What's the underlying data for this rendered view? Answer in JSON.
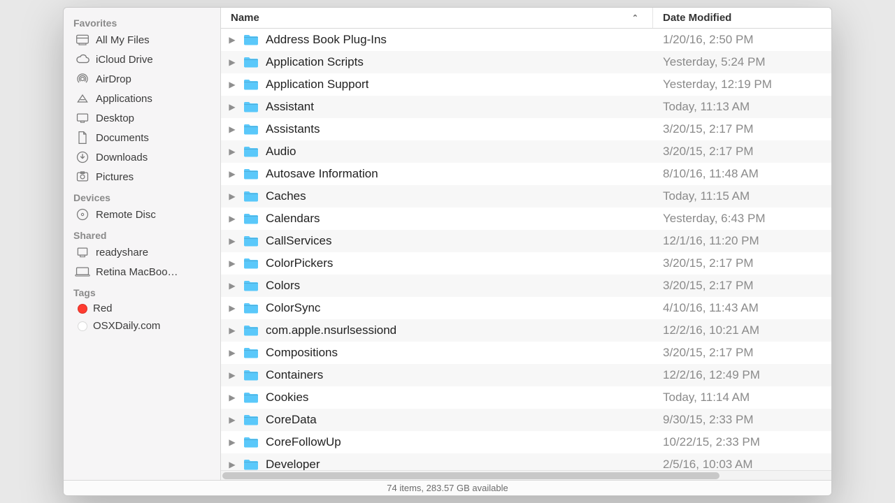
{
  "columns": {
    "name": "Name",
    "date": "Date Modified"
  },
  "sort_indicator": "ascending",
  "sidebar": {
    "sections": [
      {
        "title": "Favorites",
        "items": [
          {
            "icon": "all-my-files-icon",
            "label": "All My Files"
          },
          {
            "icon": "icloud-icon",
            "label": "iCloud Drive"
          },
          {
            "icon": "airdrop-icon",
            "label": "AirDrop"
          },
          {
            "icon": "applications-icon",
            "label": "Applications"
          },
          {
            "icon": "desktop-icon",
            "label": "Desktop"
          },
          {
            "icon": "documents-icon",
            "label": "Documents"
          },
          {
            "icon": "downloads-icon",
            "label": "Downloads"
          },
          {
            "icon": "pictures-icon",
            "label": "Pictures"
          }
        ]
      },
      {
        "title": "Devices",
        "items": [
          {
            "icon": "remote-disc-icon",
            "label": "Remote Disc"
          }
        ]
      },
      {
        "title": "Shared",
        "items": [
          {
            "icon": "pc-icon",
            "label": "readyshare"
          },
          {
            "icon": "mac-icon",
            "label": "Retina MacBoo…"
          }
        ]
      },
      {
        "title": "Tags",
        "items": [
          {
            "icon": "tag-dot",
            "color": "#ff3b30",
            "label": "Red"
          },
          {
            "icon": "tag-dot",
            "color": "#ffffff",
            "label": "OSXDaily.com"
          }
        ]
      }
    ]
  },
  "files": [
    {
      "name": "Address Book Plug-Ins",
      "date": "1/20/16, 2:50 PM"
    },
    {
      "name": "Application Scripts",
      "date": "Yesterday, 5:24 PM"
    },
    {
      "name": "Application Support",
      "date": "Yesterday, 12:19 PM"
    },
    {
      "name": "Assistant",
      "date": "Today, 11:13 AM"
    },
    {
      "name": "Assistants",
      "date": "3/20/15, 2:17 PM"
    },
    {
      "name": "Audio",
      "date": "3/20/15, 2:17 PM"
    },
    {
      "name": "Autosave Information",
      "date": "8/10/16, 11:48 AM"
    },
    {
      "name": "Caches",
      "date": "Today, 11:15 AM"
    },
    {
      "name": "Calendars",
      "date": "Yesterday, 6:43 PM"
    },
    {
      "name": "CallServices",
      "date": "12/1/16, 11:20 PM"
    },
    {
      "name": "ColorPickers",
      "date": "3/20/15, 2:17 PM"
    },
    {
      "name": "Colors",
      "date": "3/20/15, 2:17 PM"
    },
    {
      "name": "ColorSync",
      "date": "4/10/16, 11:43 AM"
    },
    {
      "name": "com.apple.nsurlsessiond",
      "date": "12/2/16, 10:21 AM"
    },
    {
      "name": "Compositions",
      "date": "3/20/15, 2:17 PM"
    },
    {
      "name": "Containers",
      "date": "12/2/16, 12:49 PM"
    },
    {
      "name": "Cookies",
      "date": "Today, 11:14 AM"
    },
    {
      "name": "CoreData",
      "date": "9/30/15, 2:33 PM"
    },
    {
      "name": "CoreFollowUp",
      "date": "10/22/15, 2:33 PM"
    },
    {
      "name": "Developer",
      "date": "2/5/16, 10:03 AM"
    }
  ],
  "status": "74 items, 283.57 GB available",
  "folder_color": "#5ac8fa"
}
